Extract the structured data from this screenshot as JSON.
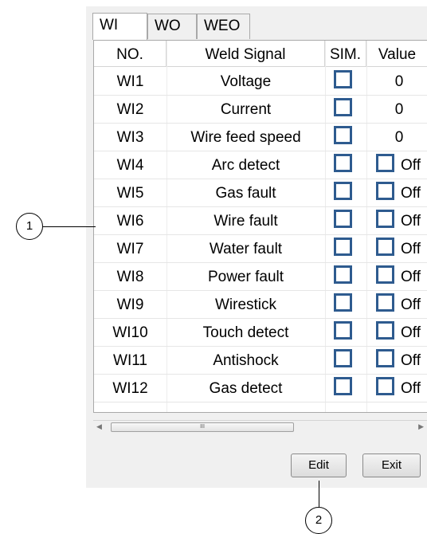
{
  "tabs": [
    {
      "label": "WI",
      "active": true
    },
    {
      "label": "WO",
      "active": false
    },
    {
      "label": "WEO",
      "active": false
    }
  ],
  "columns": [
    "NO.",
    "Weld Signal",
    "SIM.",
    "Value"
  ],
  "rows": [
    {
      "no": "WI1",
      "signal": "Voltage",
      "value_type": "number",
      "value": "0"
    },
    {
      "no": "WI2",
      "signal": "Current",
      "value_type": "number",
      "value": "0"
    },
    {
      "no": "WI3",
      "signal": "Wire feed speed",
      "value_type": "number",
      "value": "0"
    },
    {
      "no": "WI4",
      "signal": "Arc detect",
      "value_type": "toggle",
      "value": "Off"
    },
    {
      "no": "WI5",
      "signal": "Gas fault",
      "value_type": "toggle",
      "value": "Off"
    },
    {
      "no": "WI6",
      "signal": "Wire fault",
      "value_type": "toggle",
      "value": "Off"
    },
    {
      "no": "WI7",
      "signal": "Water fault",
      "value_type": "toggle",
      "value": "Off"
    },
    {
      "no": "WI8",
      "signal": "Power fault",
      "value_type": "toggle",
      "value": "Off"
    },
    {
      "no": "WI9",
      "signal": "Wirestick",
      "value_type": "toggle",
      "value": "Off"
    },
    {
      "no": "WI10",
      "signal": "Touch detect",
      "value_type": "toggle",
      "value": "Off"
    },
    {
      "no": "WI11",
      "signal": "Antishock",
      "value_type": "toggle",
      "value": "Off"
    },
    {
      "no": "WI12",
      "signal": "Gas detect",
      "value_type": "toggle",
      "value": "Off"
    }
  ],
  "scrollbar": {
    "thumb_grip": "III"
  },
  "buttons": {
    "edit": "Edit",
    "exit": "Exit"
  },
  "callouts": {
    "one": "1",
    "two": "2"
  },
  "colors": {
    "checkbox_border": "#2e5b8f",
    "panel_bg": "#f0f0f0"
  }
}
